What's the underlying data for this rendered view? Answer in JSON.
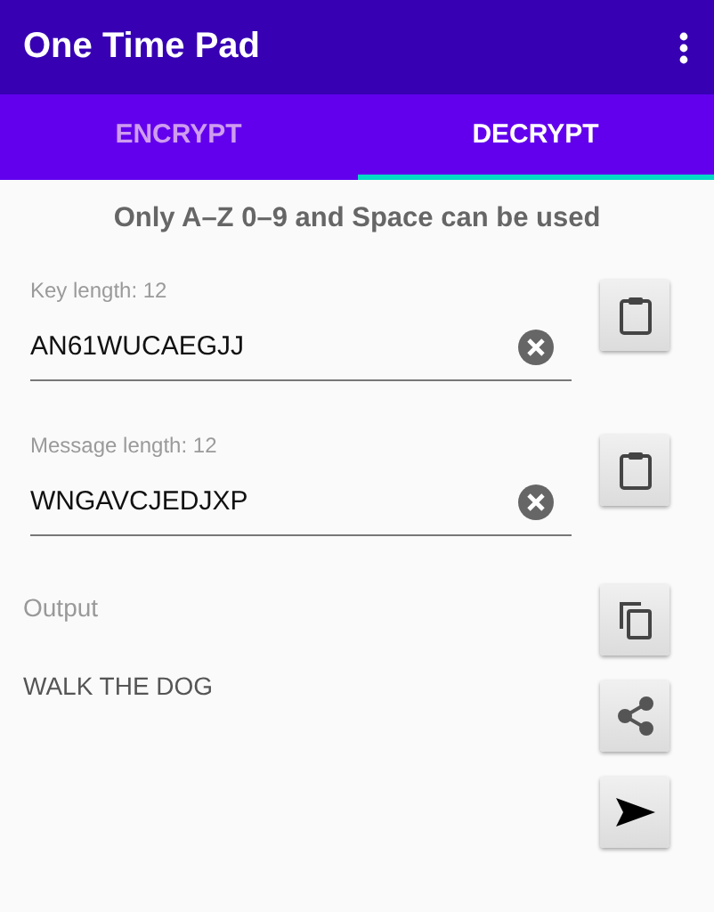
{
  "app_bar": {
    "title": "One Time Pad"
  },
  "tabs": [
    {
      "label": "ENCRYPT",
      "selected": false
    },
    {
      "label": "DECRYPT",
      "selected": true
    }
  ],
  "hint": "Only A–Z 0–9 and Space can be used",
  "fields": [
    {
      "label": "Key length: 12",
      "value": "AN61WUCAEGJJ"
    },
    {
      "label": "Message length: 12",
      "value": "WNGAVCJEDJXP"
    }
  ],
  "output": {
    "label": "Output",
    "text": "WALK THE DOG"
  },
  "actions": [
    {
      "kind": "copy"
    },
    {
      "kind": "share"
    },
    {
      "kind": "send"
    }
  ]
}
